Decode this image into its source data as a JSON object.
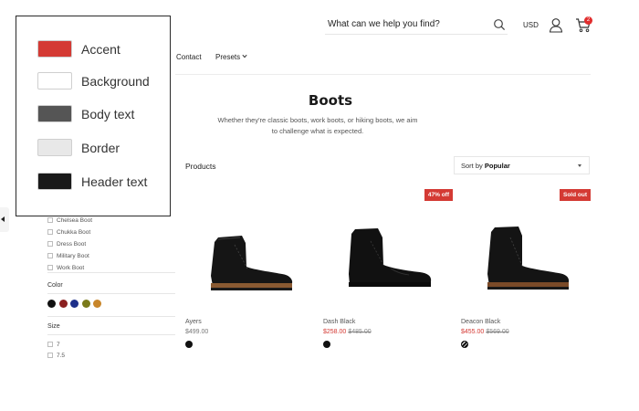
{
  "colors": {
    "accent": "#d43a34",
    "sale_price": "#d43a34",
    "cart_badge": "#e12d2d"
  },
  "header": {
    "search_placeholder": "What can we help you find?",
    "search_icon": "search-icon",
    "currency": "USD",
    "account_icon": "account-icon",
    "cart_icon": "cart-icon",
    "cart_count": "2"
  },
  "nav": {
    "items": [
      {
        "label": "Contact"
      },
      {
        "label": "Presets"
      }
    ]
  },
  "collection": {
    "title": "Boots",
    "description": "Whether they're classic boots, work boots, or hiking boots, we aim to challenge what is expected.",
    "products_label": "Products",
    "sort_prefix": "Sort by",
    "sort_value": "Popular"
  },
  "products": [
    {
      "name": "Ayers",
      "price": "$499.00",
      "sale_price": "",
      "compare_price": "",
      "badge": ""
    },
    {
      "name": "Dash Black",
      "price": "",
      "sale_price": "$258.00",
      "compare_price": "$485.00",
      "badge": "47% off"
    },
    {
      "name": "Deacon Black",
      "price": "",
      "sale_price": "$455.00",
      "compare_price": "$569.00",
      "badge": "Sold out"
    }
  ],
  "filters": {
    "style_options": [
      "Chelsea Boot",
      "Chukka Boot",
      "Dress Boot",
      "Military Boot",
      "Work Boot"
    ],
    "color_heading": "Color",
    "color_swatches": [
      "#111111",
      "#8b2020",
      "#1d2f8a",
      "#7a7a1a",
      "#c8862a"
    ],
    "size_heading": "Size",
    "size_options": [
      "7",
      "7.5"
    ]
  },
  "settings_popover": {
    "items": [
      {
        "label": "Accent",
        "color": "#d43a34"
      },
      {
        "label": "Background",
        "color": "#ffffff"
      },
      {
        "label": "Body text",
        "color": "#555555"
      },
      {
        "label": "Border",
        "color": "#e8e8e8"
      },
      {
        "label": "Header text",
        "color": "#1a1a1a"
      }
    ]
  }
}
